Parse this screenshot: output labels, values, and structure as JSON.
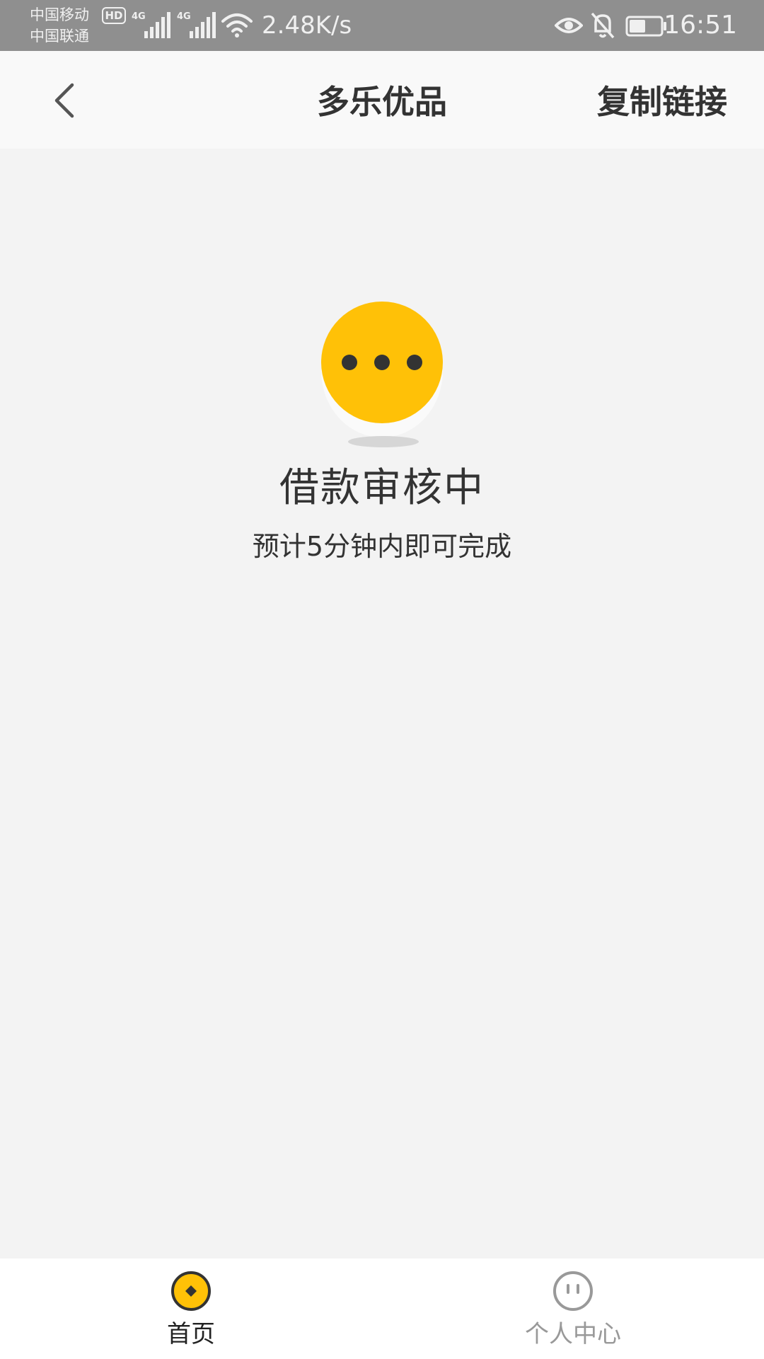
{
  "status_bar": {
    "carrier_1": "中国移动",
    "carrier_2": "中国联通",
    "hd_badge": "HD",
    "signal_1_tag": "4G",
    "signal_2_tag": "4G",
    "net_speed": "2.48K/s",
    "time": "16:51",
    "icons": [
      "wifi-icon",
      "eye-icon",
      "bell-off-icon",
      "battery-icon"
    ]
  },
  "nav": {
    "back_icon": "chevron-left-icon",
    "title": "多乐优品",
    "copy_link_label": "复制链接"
  },
  "main": {
    "illustration_icon": "pending-dots-icon",
    "status_title": "借款审核中",
    "status_subtitle": "预计5分钟内即可完成"
  },
  "tab_bar": {
    "tabs": [
      {
        "label": "首页",
        "icon": "home-coin-icon",
        "active": true
      },
      {
        "label": "个人中心",
        "icon": "profile-face-icon",
        "active": false
      }
    ]
  },
  "colors": {
    "accent": "#FFC107",
    "status_bar_bg": "#8F8F8F",
    "page_bg": "#F3F3F3",
    "text_primary": "#333333",
    "tab_inactive": "#999999"
  }
}
